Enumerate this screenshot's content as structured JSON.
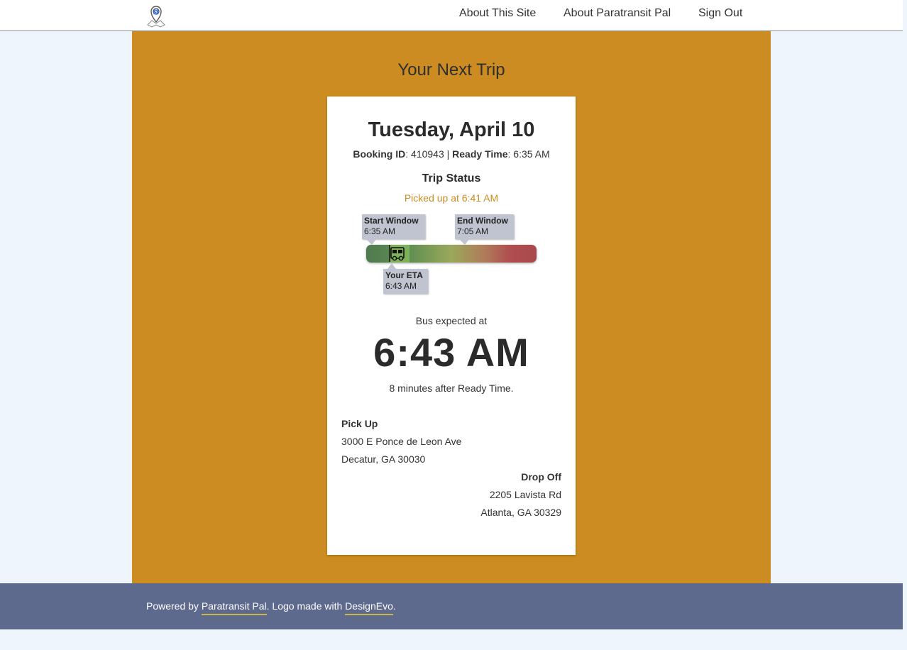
{
  "nav": {
    "links": [
      "About This Site",
      "About Paratransit Pal",
      "Sign Out"
    ]
  },
  "page": {
    "heading": "Your Next Trip"
  },
  "trip": {
    "date": "Tuesday, April 10",
    "booking_id_label": "Booking ID",
    "booking_id": "410943",
    "separator": "|",
    "ready_time_label": "Ready Time",
    "ready_time": "6:35 AM",
    "status_title": "Trip Status",
    "status_text": "Picked up at 6:41 AM",
    "timeline": {
      "start_window_label": "Start Window",
      "start_window_time": "6:35 AM",
      "end_window_label": "End Window",
      "end_window_time": "7:05 AM",
      "eta_label": "Your ETA",
      "eta_time": "6:43 AM"
    },
    "expected_label": "Bus expected at",
    "eta_big": "6:43 AM",
    "eta_note": "8 minutes after Ready Time.",
    "pickup": {
      "title": "Pick Up",
      "line1": "3000 E Ponce de Leon Ave",
      "line2": "Decatur, GA 30030"
    },
    "dropoff": {
      "title": "Drop Off",
      "line1": "2205 Lavista Rd",
      "line2": "Atlanta, GA 30329"
    }
  },
  "footer": {
    "prefix": "Powered by",
    "link1": "Paratransit Pal",
    "middle": ". Logo made with",
    "link2": "DesignEvo",
    "suffix": "."
  },
  "colors": {
    "accent": "#cc8c21",
    "footer_bg": "#5d6a8e",
    "page_bg": "#eef5fd",
    "tooltip_bg": "#c0c4d0"
  },
  "icons": {
    "logo": "map-pin-logo-icon",
    "bus": "bus-icon"
  }
}
